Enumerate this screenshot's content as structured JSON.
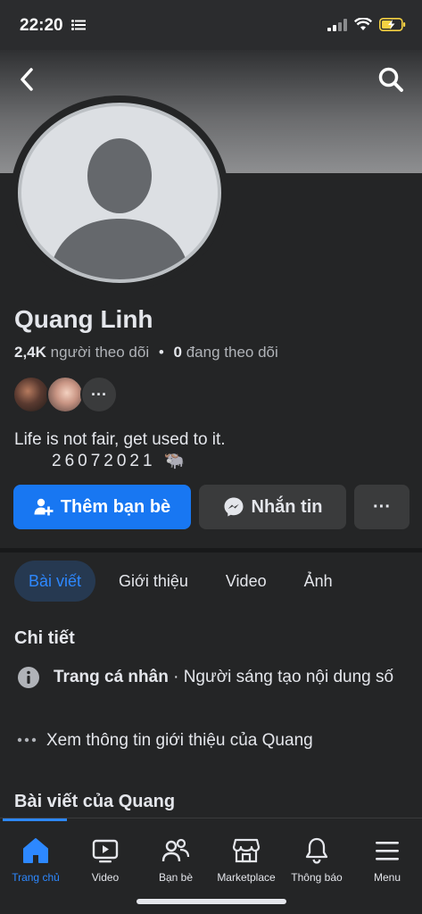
{
  "status_bar": {
    "time": "22:20"
  },
  "profile": {
    "name": "Quang Linh",
    "followers_count": "2,4K",
    "followers_label": "người theo dõi",
    "separator": "•",
    "following_count": "0",
    "following_label": "đang theo dõi",
    "friends_more": "···",
    "bio_line1": "Life is not fair, get used to it.",
    "bio_line2": "26072021 🐃"
  },
  "actions": {
    "add_friend": "Thêm bạn bè",
    "message": "Nhắn tin",
    "more": "···"
  },
  "tabs": [
    {
      "label": "Bài viết"
    },
    {
      "label": "Giới thiệu"
    },
    {
      "label": "Video"
    },
    {
      "label": "Ảnh"
    }
  ],
  "details": {
    "title": "Chi tiết",
    "page_type_bold": "Trang cá nhân",
    "page_type_rest": " · Người sáng tạo nội dung số",
    "see_more": "Xem thông tin giới thiệu của Quang"
  },
  "posts": {
    "title": "Bài viết của Quang"
  },
  "nav": [
    {
      "label": "Trang chủ",
      "icon": "home-icon"
    },
    {
      "label": "Video",
      "icon": "video-icon"
    },
    {
      "label": "Bạn bè",
      "icon": "friends-icon"
    },
    {
      "label": "Marketplace",
      "icon": "marketplace-icon"
    },
    {
      "label": "Thông báo",
      "icon": "bell-icon"
    },
    {
      "label": "Menu",
      "icon": "menu-icon"
    }
  ],
  "colors": {
    "accent": "#1877f2",
    "background": "#242526",
    "active_tab": "#2d88ff"
  }
}
